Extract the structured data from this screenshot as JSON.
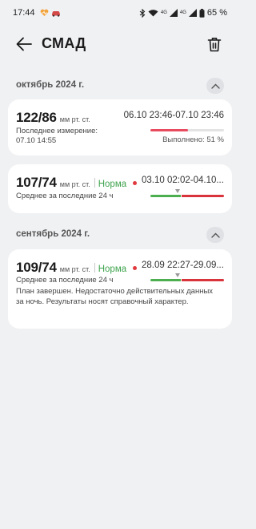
{
  "status_bar": {
    "time": "17:44",
    "battery": "65 %",
    "network_1": "4G",
    "network_2": "4G",
    "icons": [
      "notification-heart-icon",
      "car-icon",
      "bluetooth-icon",
      "wifi-icon",
      "signal-icon",
      "battery-icon"
    ]
  },
  "header": {
    "title": "СМАД",
    "back_icon": "arrow-left-icon",
    "delete_icon": "trash-icon"
  },
  "sections": [
    {
      "month": "октябрь 2024 г.",
      "records": [
        {
          "value": "122/86",
          "unit": "мм рт. ст.",
          "date_range": "06.10 23:46-07.10 23:46",
          "subtitle": "Последнее измерение: 07.10 14:55",
          "done_label": "Выполнено:",
          "done_percent": "51 %",
          "progress": 0.51
        },
        {
          "value": "107/74",
          "unit": "мм рт. ст.",
          "status": "Норма",
          "date_range": "03.10 02:02-04.10...",
          "subtitle": "Среднее за последние 24 ч"
        }
      ]
    },
    {
      "month": "сентябрь 2024 г.",
      "records": [
        {
          "value": "109/74",
          "unit": "мм рт. ст.",
          "status": "Норма",
          "date_range": "28.09 22:27-29.09...",
          "subtitle": "Среднее за последние 24 ч",
          "note": "План завершен. Недостаточно действительных данных за ночь. Результаты носят справочный характер."
        }
      ]
    }
  ],
  "colors": {
    "background": "#f0f1f3",
    "card": "#ffffff",
    "norm_green": "#3fa34d",
    "alert_red": "#d9343c",
    "progress_pink": "#e84a5f"
  }
}
